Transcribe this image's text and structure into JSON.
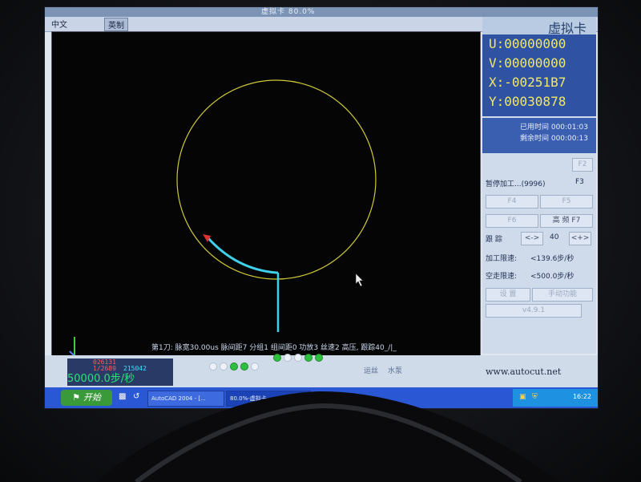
{
  "window": {
    "title_strip": "虚拟卡 80.0%"
  },
  "menu": {
    "chinese": "中文",
    "english": "英制"
  },
  "app_title": "虚拟卡",
  "coords": {
    "u": "U:00000000",
    "v": "V:00000000",
    "x": "X:-00251B7",
    "y": "Y:00030878"
  },
  "times": {
    "used_label": "已用时间",
    "used": "000:01:03",
    "remain_label": "剩余时间",
    "remain": "000:00:13"
  },
  "buttons": {
    "f2": "F2",
    "pause": "暂停加工...(9996)",
    "f3": "F3",
    "f4": "F4",
    "f5": "F5",
    "f6": "F6",
    "f7": "F7",
    "high_freq": "高 频"
  },
  "tracking": {
    "label": "跟 踪",
    "minus": "<->",
    "value": "40",
    "plus": "<+>"
  },
  "speed_limits": {
    "proc_label": "加工限速:",
    "proc_value": "<139.6步/秒",
    "idle_label": "空走限速:",
    "idle_value": "<500.0步/秒"
  },
  "extra": {
    "settings": "设 置",
    "manual": "手动功能"
  },
  "version": "v4.9.1",
  "status_line": "第1刀: 脉宽30.00us 脉间距7 分组1 组间距0 功放3 丝速2 高压, 跟踪40_/|_",
  "counters": {
    "c1": "026131",
    "c2": "1/2689",
    "c3": "215042",
    "speed": "50000.0步/秒"
  },
  "process_tabs": [
    "运丝",
    "水泵"
  ],
  "dots": {
    "group1": [
      false,
      false,
      true,
      true,
      false
    ],
    "group2": [
      true,
      false,
      false,
      true,
      true
    ]
  },
  "website": "www.autocut.net",
  "taskbar": {
    "start": "开始",
    "tasks": [
      "AutoCAD 2004 - [...",
      "80.0%-虚拟卡 -..."
    ],
    "clock": "16:22"
  },
  "colors": {
    "circle": "#cfc83a",
    "toolpath": "#3fd0ea",
    "arrow": "#e03232",
    "coord_text": "#f2e86a",
    "accent": "#2f52a3"
  }
}
